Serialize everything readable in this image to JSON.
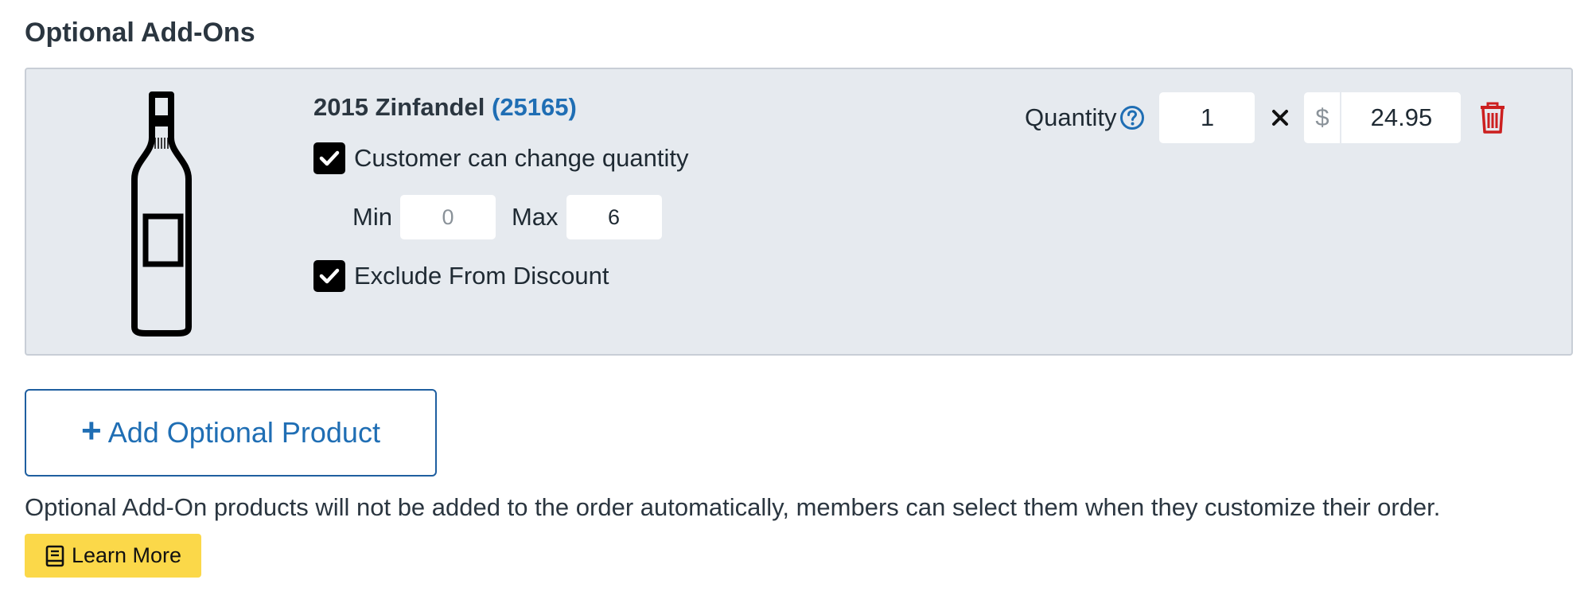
{
  "section": {
    "title": "Optional Add-Ons"
  },
  "product": {
    "name": "2015 Zinfandel",
    "sku_open": "(",
    "sku": "25165",
    "sku_close": ")",
    "image_icon": "wine-bottle-icon",
    "customer_can_change_quantity": {
      "label": "Customer can change quantity",
      "checked": true
    },
    "min": {
      "label": "Min",
      "placeholder": "0",
      "value": ""
    },
    "max": {
      "label": "Max",
      "value": "6"
    },
    "exclude_from_discount": {
      "label": "Exclude From Discount",
      "checked": true
    },
    "quantity": {
      "label": "Quantity",
      "value": "1",
      "help_icon": "question-circle-icon"
    },
    "multiply_icon": "times-icon",
    "price": {
      "currency": "$",
      "value": "24.95"
    },
    "delete_icon": "trash-icon"
  },
  "add_button": {
    "plus": "+",
    "label": "Add Optional Product"
  },
  "help_text": "Optional Add-On products will not be added to the order automatically, members can select them when they customize their order.",
  "learn_more": {
    "label": "Learn More",
    "icon": "book-icon"
  },
  "colors": {
    "accent": "#1f6eb4",
    "card_bg": "#e6eaef",
    "danger": "#cc1f1f",
    "learn_more_bg": "#fbd849"
  }
}
